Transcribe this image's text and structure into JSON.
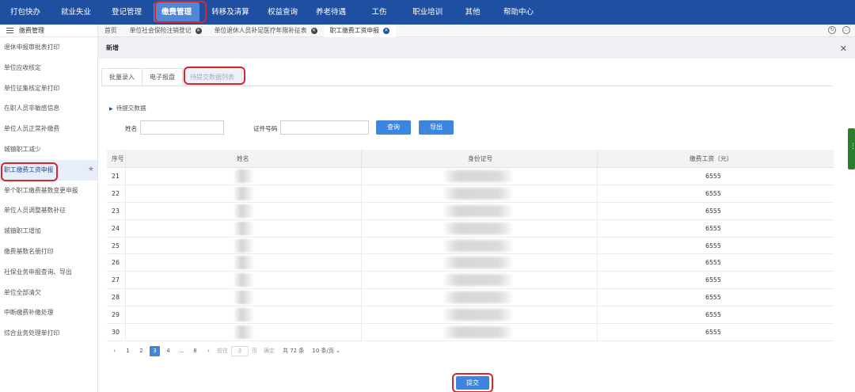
{
  "topnav": {
    "items": [
      "打包快办",
      "就业失业",
      "登记管理",
      "缴费管理",
      "转移及清算",
      "权益查询",
      "养老待遇",
      "工伤",
      "职业培训",
      "其他",
      "帮助中心"
    ],
    "active_index": 3
  },
  "sidebar": {
    "title": "缴费管理",
    "items": [
      "退休申报审批表打印",
      "单位应收核定",
      "单位征集核定单打印",
      "在职人员非敏感信息",
      "单位人员正常补缴费",
      "城镇职工减少",
      "职工缴费工资申报",
      "单个职工缴费基数变更申报",
      "单位人员调整基数补征",
      "城镇职工增加",
      "缴费基数名册打印",
      "社保业务申报查询、导出",
      "单位全部清欠",
      "中断缴费补缴处理",
      "综合业务处理单打印"
    ],
    "active_index": 6,
    "star_icon": "star-icon"
  },
  "tabs": [
    {
      "label": "首页",
      "closable": false
    },
    {
      "label": "单位社会保险注销登记",
      "closable": true
    },
    {
      "label": "单位退休人员补足医疗年限补征表",
      "closable": true
    },
    {
      "label": "职工缴费工资申报",
      "closable": true,
      "active": true
    }
  ],
  "panel": {
    "title": "新增",
    "subtabs": [
      "批量录入",
      "电子报盘",
      "待提交数据列表"
    ],
    "active_subtab": 2,
    "section_title": "待提交数据",
    "search": {
      "name_label": "姓名",
      "name_value": "",
      "id_label": "证件号码",
      "id_value": "",
      "query_button": "查询",
      "export_button": "导出"
    },
    "table": {
      "headers": [
        "序号",
        "姓名",
        "身份证号",
        "缴费工资（元）"
      ],
      "rows": [
        {
          "no": "21",
          "wage": "6555"
        },
        {
          "no": "22",
          "wage": "6555"
        },
        {
          "no": "23",
          "wage": "6555"
        },
        {
          "no": "24",
          "wage": "6555"
        },
        {
          "no": "25",
          "wage": "6555"
        },
        {
          "no": "26",
          "wage": "6555"
        },
        {
          "no": "27",
          "wage": "6555"
        },
        {
          "no": "28",
          "wage": "6555"
        },
        {
          "no": "29",
          "wage": "6555"
        },
        {
          "no": "30",
          "wage": "6555"
        }
      ]
    },
    "pager": {
      "pages": [
        "1",
        "2",
        "3",
        "4",
        "...",
        "8"
      ],
      "current": "3",
      "goto_label": "前往",
      "goto_value": "3",
      "page_unit": "页",
      "confirm": "确定",
      "total": "共 72 条",
      "page_size": "10 条/页"
    },
    "submit_button": "提交"
  },
  "colors": {
    "nav_bg": "#1e4fa1",
    "nav_active": "#4f86d6",
    "button_blue": "#3d86e0",
    "highlight_ring": "#d9262c"
  }
}
